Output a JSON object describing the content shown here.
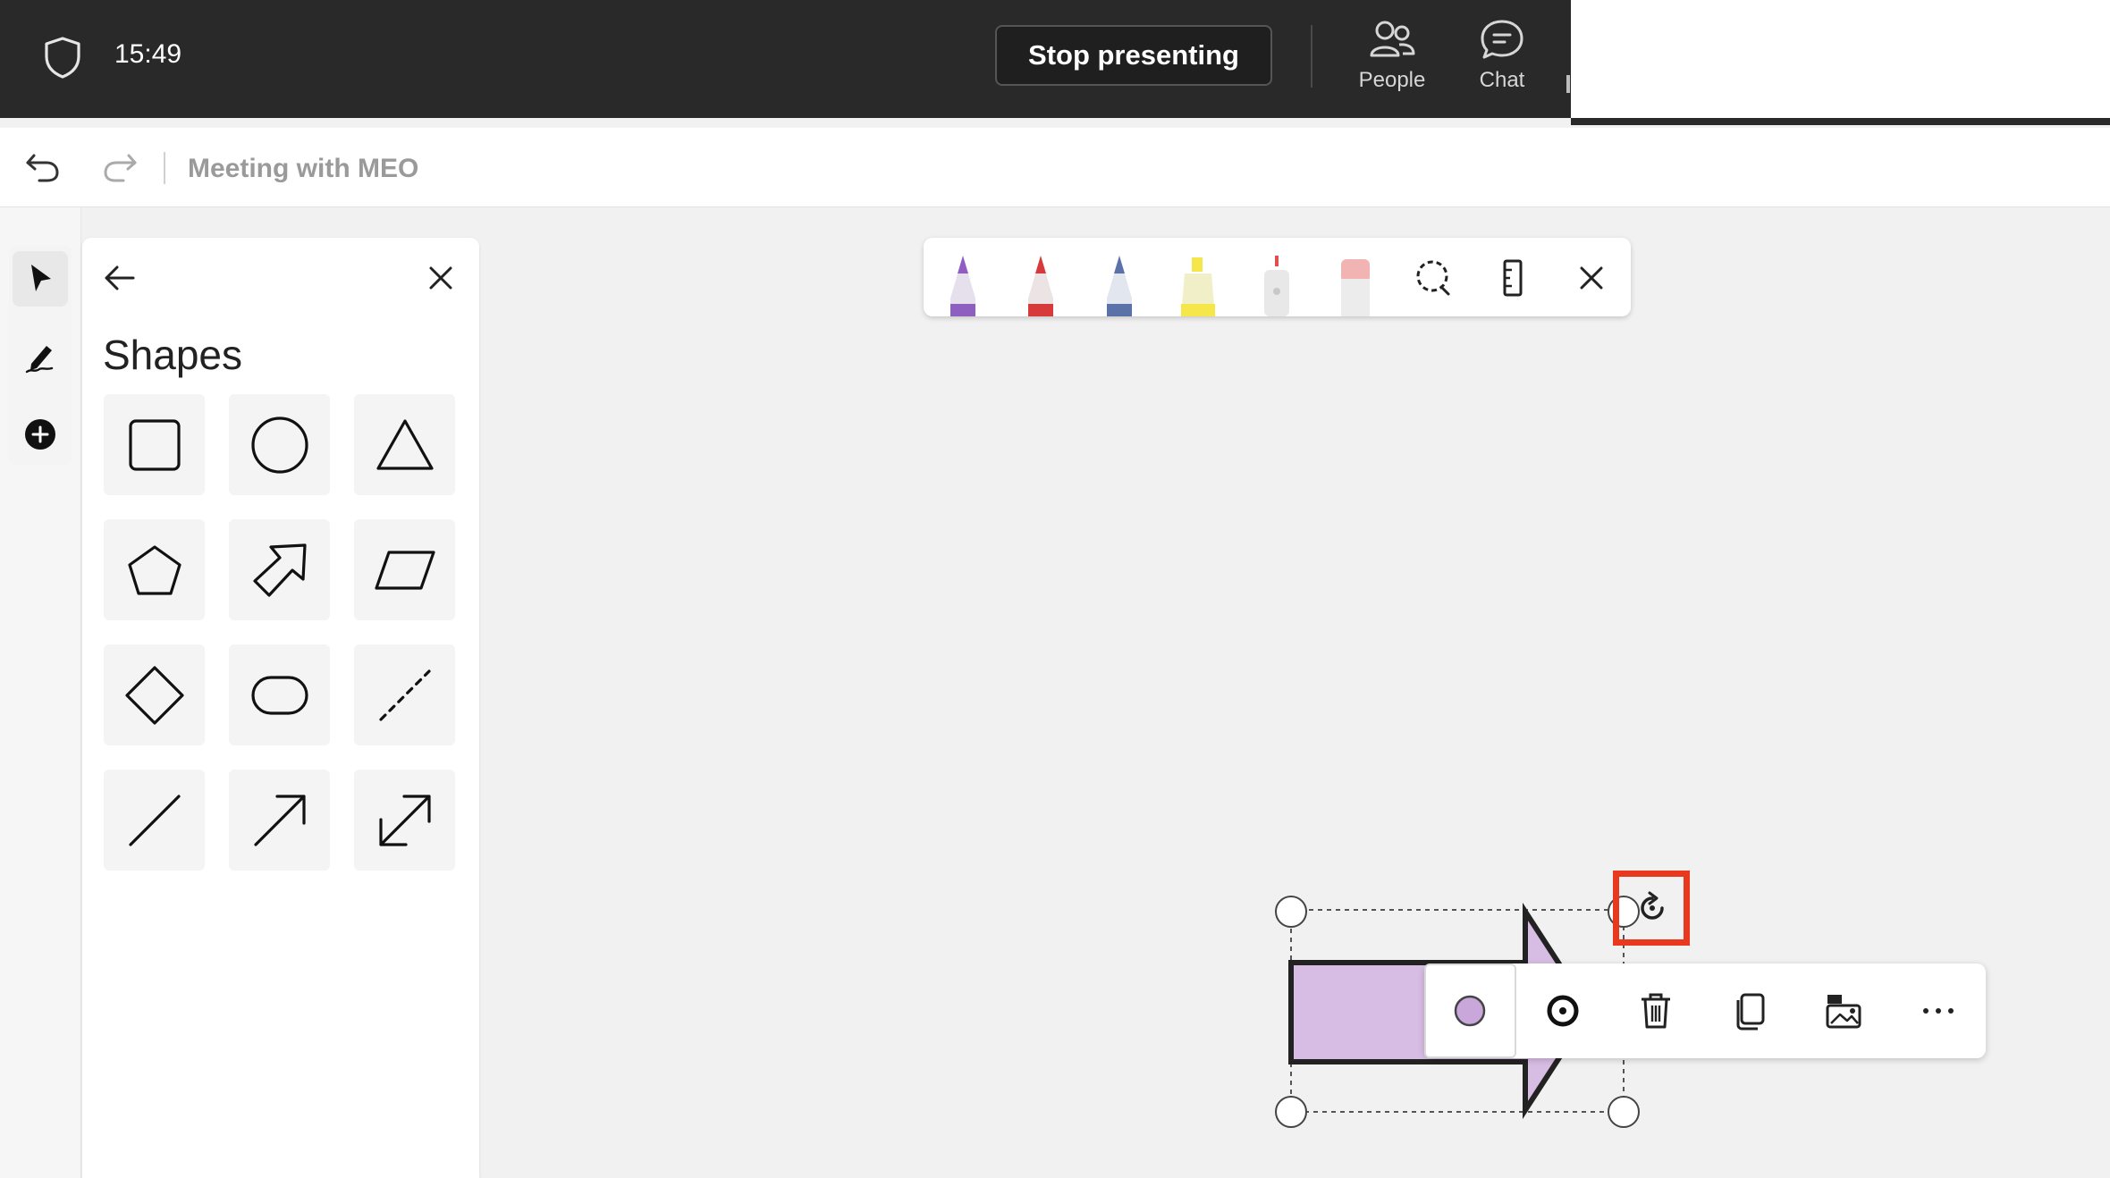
{
  "top_bar": {
    "time": "15:49",
    "stop_presenting_label": "Stop presenting",
    "people_label": "People",
    "chat_label": "Chat"
  },
  "doc_bar": {
    "title": "Meeting with MEO"
  },
  "shapes_panel": {
    "title": "Shapes",
    "shapes": [
      "square",
      "circle",
      "triangle",
      "pentagon",
      "arrow-block",
      "parallelogram",
      "diamond",
      "rounded-rectangle",
      "dashed-line",
      "line",
      "arrow",
      "double-arrow"
    ]
  },
  "pen_toolbar": {
    "tools": [
      {
        "name": "purple-pen",
        "color": "#8e5fc0"
      },
      {
        "name": "red-pen",
        "color": "#d63a3a"
      },
      {
        "name": "galaxy-pen",
        "color": "#5a72a8"
      },
      {
        "name": "highlighter",
        "color": "#f5e64a"
      },
      {
        "name": "laser-pointer",
        "color": "#e0e0e0"
      },
      {
        "name": "eraser",
        "color": "#f2b3b3"
      }
    ]
  },
  "canvas": {
    "selected_shape": {
      "type": "block-arrow",
      "fill_color": "#d7bde3",
      "outline_color": "#222222"
    }
  },
  "context_toolbar": {
    "fill_color": "#c9a7db"
  },
  "colors": {
    "highlight": "#e8391f",
    "top_bar_bg": "#292929"
  }
}
